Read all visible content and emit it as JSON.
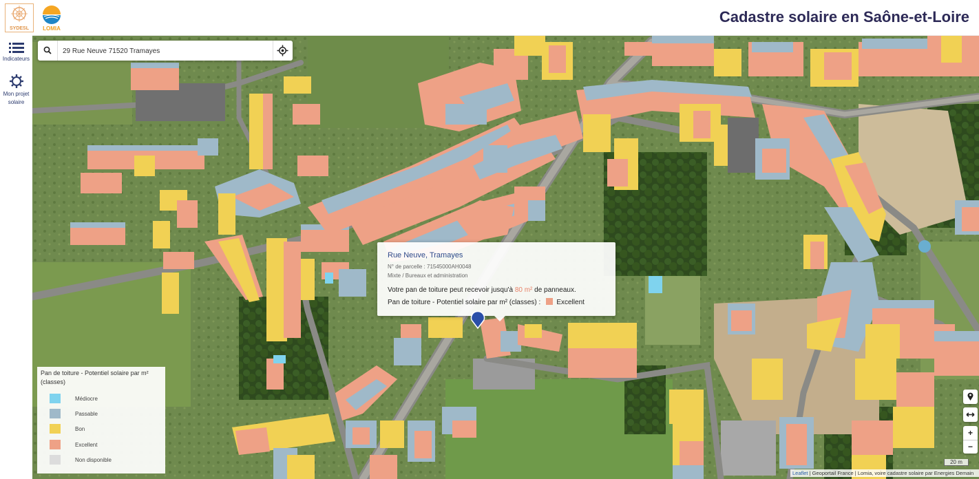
{
  "header": {
    "title": "Cadastre solaire en Saône-et-Loire",
    "logo_left_text": "SYDESL",
    "logo_right_text": "LOMIA"
  },
  "sidebar": {
    "items": [
      {
        "label": "Indicateurs",
        "icon": "list-icon"
      },
      {
        "label": "Mon projet solaire",
        "icon": "gear-icon"
      }
    ]
  },
  "search": {
    "value": "29 Rue Neuve 71520 Tramayes",
    "placeholder": ""
  },
  "popup": {
    "title": "Rue Neuve, Tramayes",
    "parcel": "N° de parcelle : 71545000AH0048",
    "usage": "Mixte / Bureaux et administration",
    "sentence_pre": "Votre pan de toiture peut recevoir jusqu'à ",
    "surface": "80 m²",
    "sentence_post": " de panneaux.",
    "class_label": "Pan de toiture - Potentiel solaire par m² (classes) :",
    "class_value": "Excellent",
    "class_color": "#eea186"
  },
  "legend": {
    "title": "Pan de toiture - Potentiel solaire par m² (classes)",
    "items": [
      {
        "label": "Médiocre",
        "color": "#7fd3ee"
      },
      {
        "label": "Passable",
        "color": "#9fb9c9"
      },
      {
        "label": "Bon",
        "color": "#f1d154"
      },
      {
        "label": "Excellent",
        "color": "#eea186"
      },
      {
        "label": "Non disponible",
        "color": "#dcdcdc"
      }
    ]
  },
  "controls": {
    "zoom_in": "+",
    "zoom_out": "−",
    "scale": "20 m"
  },
  "attribution": {
    "leaflet": "Leaflet",
    "geoportail": "Geoportail France",
    "text": "Lomia, voire cadastre solaire par Energies Demain"
  }
}
